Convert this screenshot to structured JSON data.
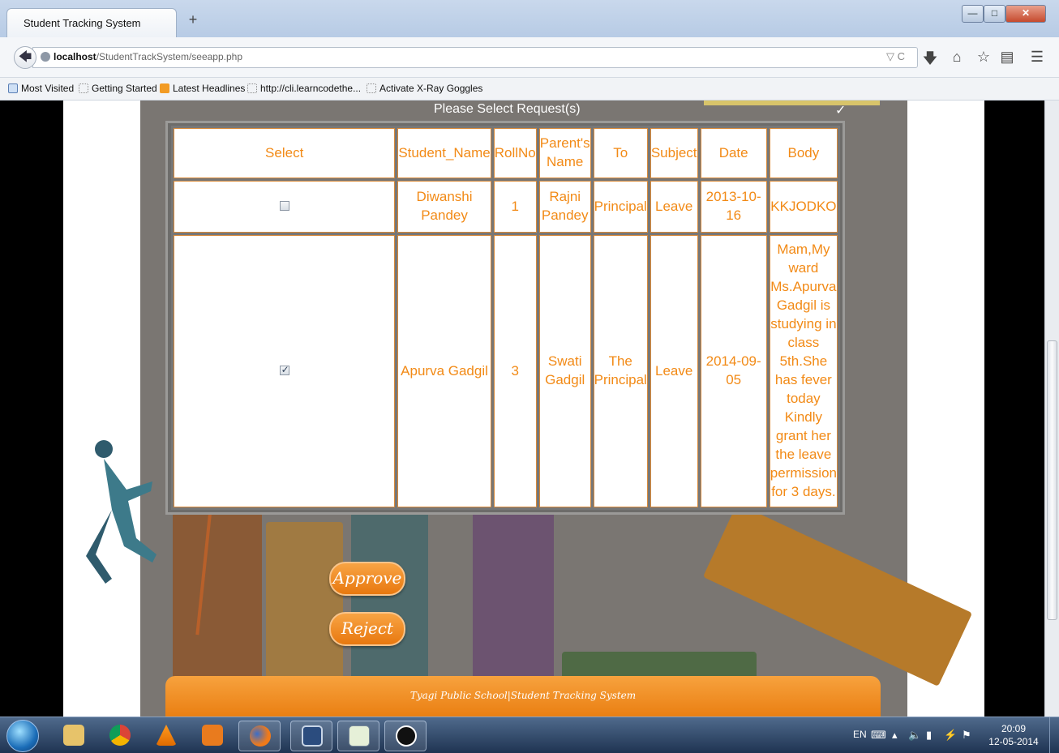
{
  "browser": {
    "tab_title": "Student Tracking System",
    "new_tab": "+",
    "url_host": "localhost",
    "url_path": "/StudentTrackSystem/seeapp.php",
    "bookmarks": [
      "Most Visited",
      "Getting Started",
      "Latest Headlines",
      "http://cli.learncodethe...",
      "Activate X-Ray Goggles"
    ]
  },
  "page": {
    "heading": "Please Select Request(s)",
    "columns": [
      "Select",
      "Student_Name",
      "RollNo",
      "Parent's Name",
      "To",
      "Subject",
      "Date",
      "Body"
    ],
    "rows": [
      {
        "checked": false,
        "student_name": "Diwanshi Pandey",
        "roll_no": "1",
        "parent_name": "Rajni Pandey",
        "to": "Principal",
        "subject": "Leave",
        "date": "2013-10-16",
        "body": "KKJODKO"
      },
      {
        "checked": true,
        "student_name": "Apurva Gadgil",
        "roll_no": "3",
        "parent_name": "Swati Gadgil",
        "to": "The Principal",
        "subject": "Leave",
        "date": "2014-09-05",
        "body": "Mam,My ward Ms.Apurva Gadgil is studying in class 5th.She has fever today Kindly grant her the leave permission for 3 days."
      }
    ],
    "approve_label": "Approve",
    "reject_label": "Reject",
    "footer": "Tyagi Public School|Student Tracking System"
  },
  "taskbar": {
    "lang": "EN",
    "time": "20:09",
    "date": "12-05-2014"
  },
  "colors": {
    "accent": "#f28a16",
    "button": "#ea7f12"
  }
}
